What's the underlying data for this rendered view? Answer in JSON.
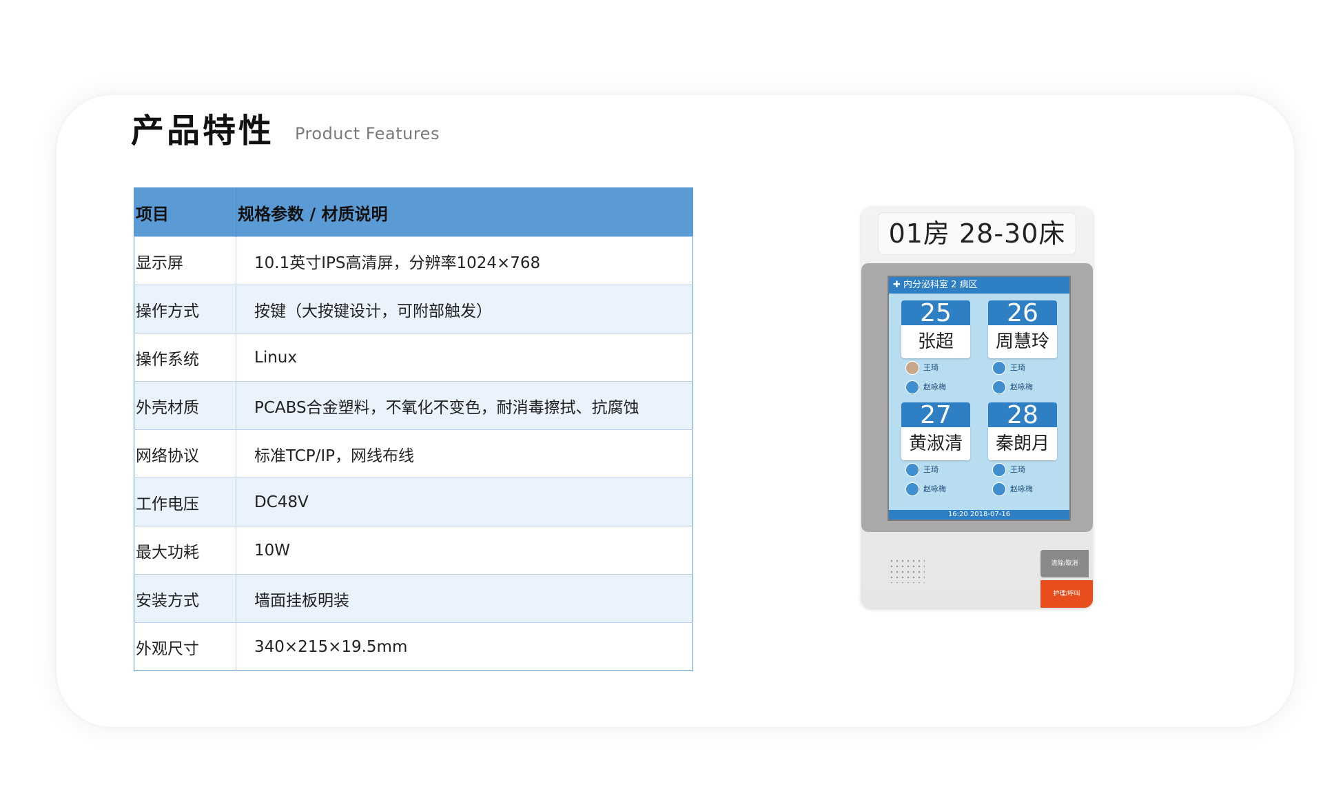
{
  "title": {
    "cn": "产品特性",
    "en": "Product Features"
  },
  "table": {
    "headers": [
      "项目",
      "规格参数 / 材质说明"
    ],
    "rows": [
      {
        "k": "显示屏",
        "v": "10.1英寸IPS高清屏，分辨率1024×768"
      },
      {
        "k": "操作方式",
        "v": "按键（大按键设计，可附部触发）"
      },
      {
        "k": "操作系统",
        "v": "Linux"
      },
      {
        "k": "外壳材质",
        "v": "PCABS合金塑料，不氧化不变色，耐消毒擦拭、抗腐蚀"
      },
      {
        "k": "网络协议",
        "v": "标准TCP/IP，网线布线"
      },
      {
        "k": "工作电压",
        "v": "DC48V"
      },
      {
        "k": "最大功耗",
        "v": "10W"
      },
      {
        "k": "安装方式",
        "v": "墙面挂板明装"
      },
      {
        "k": "外观尺寸",
        "v": "340×215×19.5mm"
      }
    ]
  },
  "device": {
    "label": "01房  28-30床",
    "header": "✚ 内分泌科室 2 病区",
    "footer": "16:20  2018-07-16",
    "beds": [
      {
        "num": "25",
        "name": "张超",
        "doctor": "王琦",
        "nurse": "赵咏梅"
      },
      {
        "num": "26",
        "name": "周慧玲",
        "doctor": "王琦",
        "nurse": "赵咏梅"
      },
      {
        "num": "27",
        "name": "黄淑清",
        "doctor": "王琦",
        "nurse": "赵咏梅"
      },
      {
        "num": "28",
        "name": "秦朗月",
        "doctor": "王琦",
        "nurse": "赵咏梅"
      }
    ],
    "button_gray": "清除/取消",
    "button_red": "护理/呼叫"
  }
}
